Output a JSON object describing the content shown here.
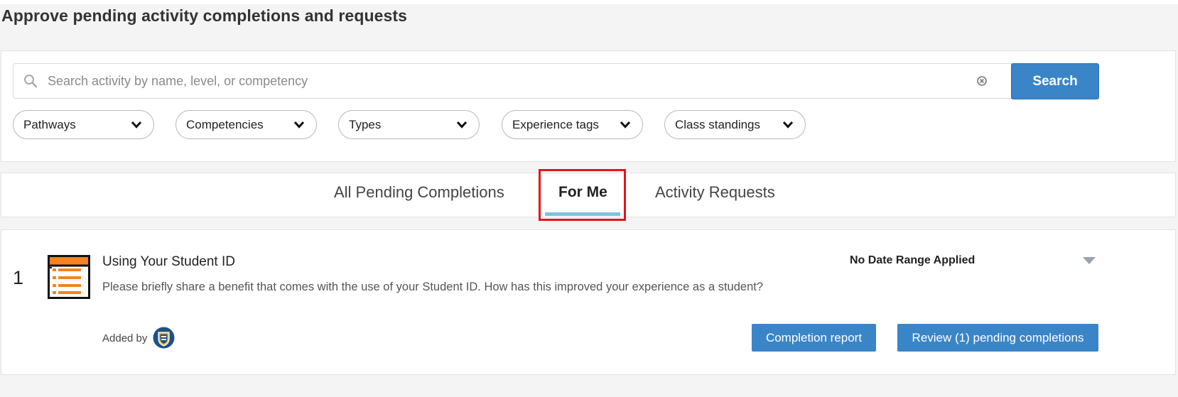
{
  "page": {
    "title": "Approve pending activity completions and requests"
  },
  "search": {
    "placeholder": "Search activity by name, level, or competency",
    "value": "",
    "button_label": "Search"
  },
  "filters": [
    {
      "label": "Pathways"
    },
    {
      "label": "Competencies"
    },
    {
      "label": "Types"
    },
    {
      "label": "Experience tags"
    },
    {
      "label": "Class standings"
    }
  ],
  "tabs": [
    {
      "label": "All Pending Completions",
      "active": false
    },
    {
      "label": "For Me",
      "active": true
    },
    {
      "label": "Activity Requests",
      "active": false
    }
  ],
  "activities": [
    {
      "number": "1",
      "icon": "list-document-icon",
      "title": "Using Your Student ID",
      "description": "Please briefly share a benefit that comes with the use of your Student ID. How has this improved your experience as a student?",
      "date_range": "No Date Range Applied",
      "added_by_label": "Added by",
      "actions": {
        "completion_report": "Completion report",
        "review_pending": "Review (1) pending completions"
      }
    }
  ],
  "colors": {
    "accent": "#3a85c8",
    "tab_underline": "#7cc4e3",
    "highlight": "#e3141a",
    "icon_orange": "#f58220"
  }
}
